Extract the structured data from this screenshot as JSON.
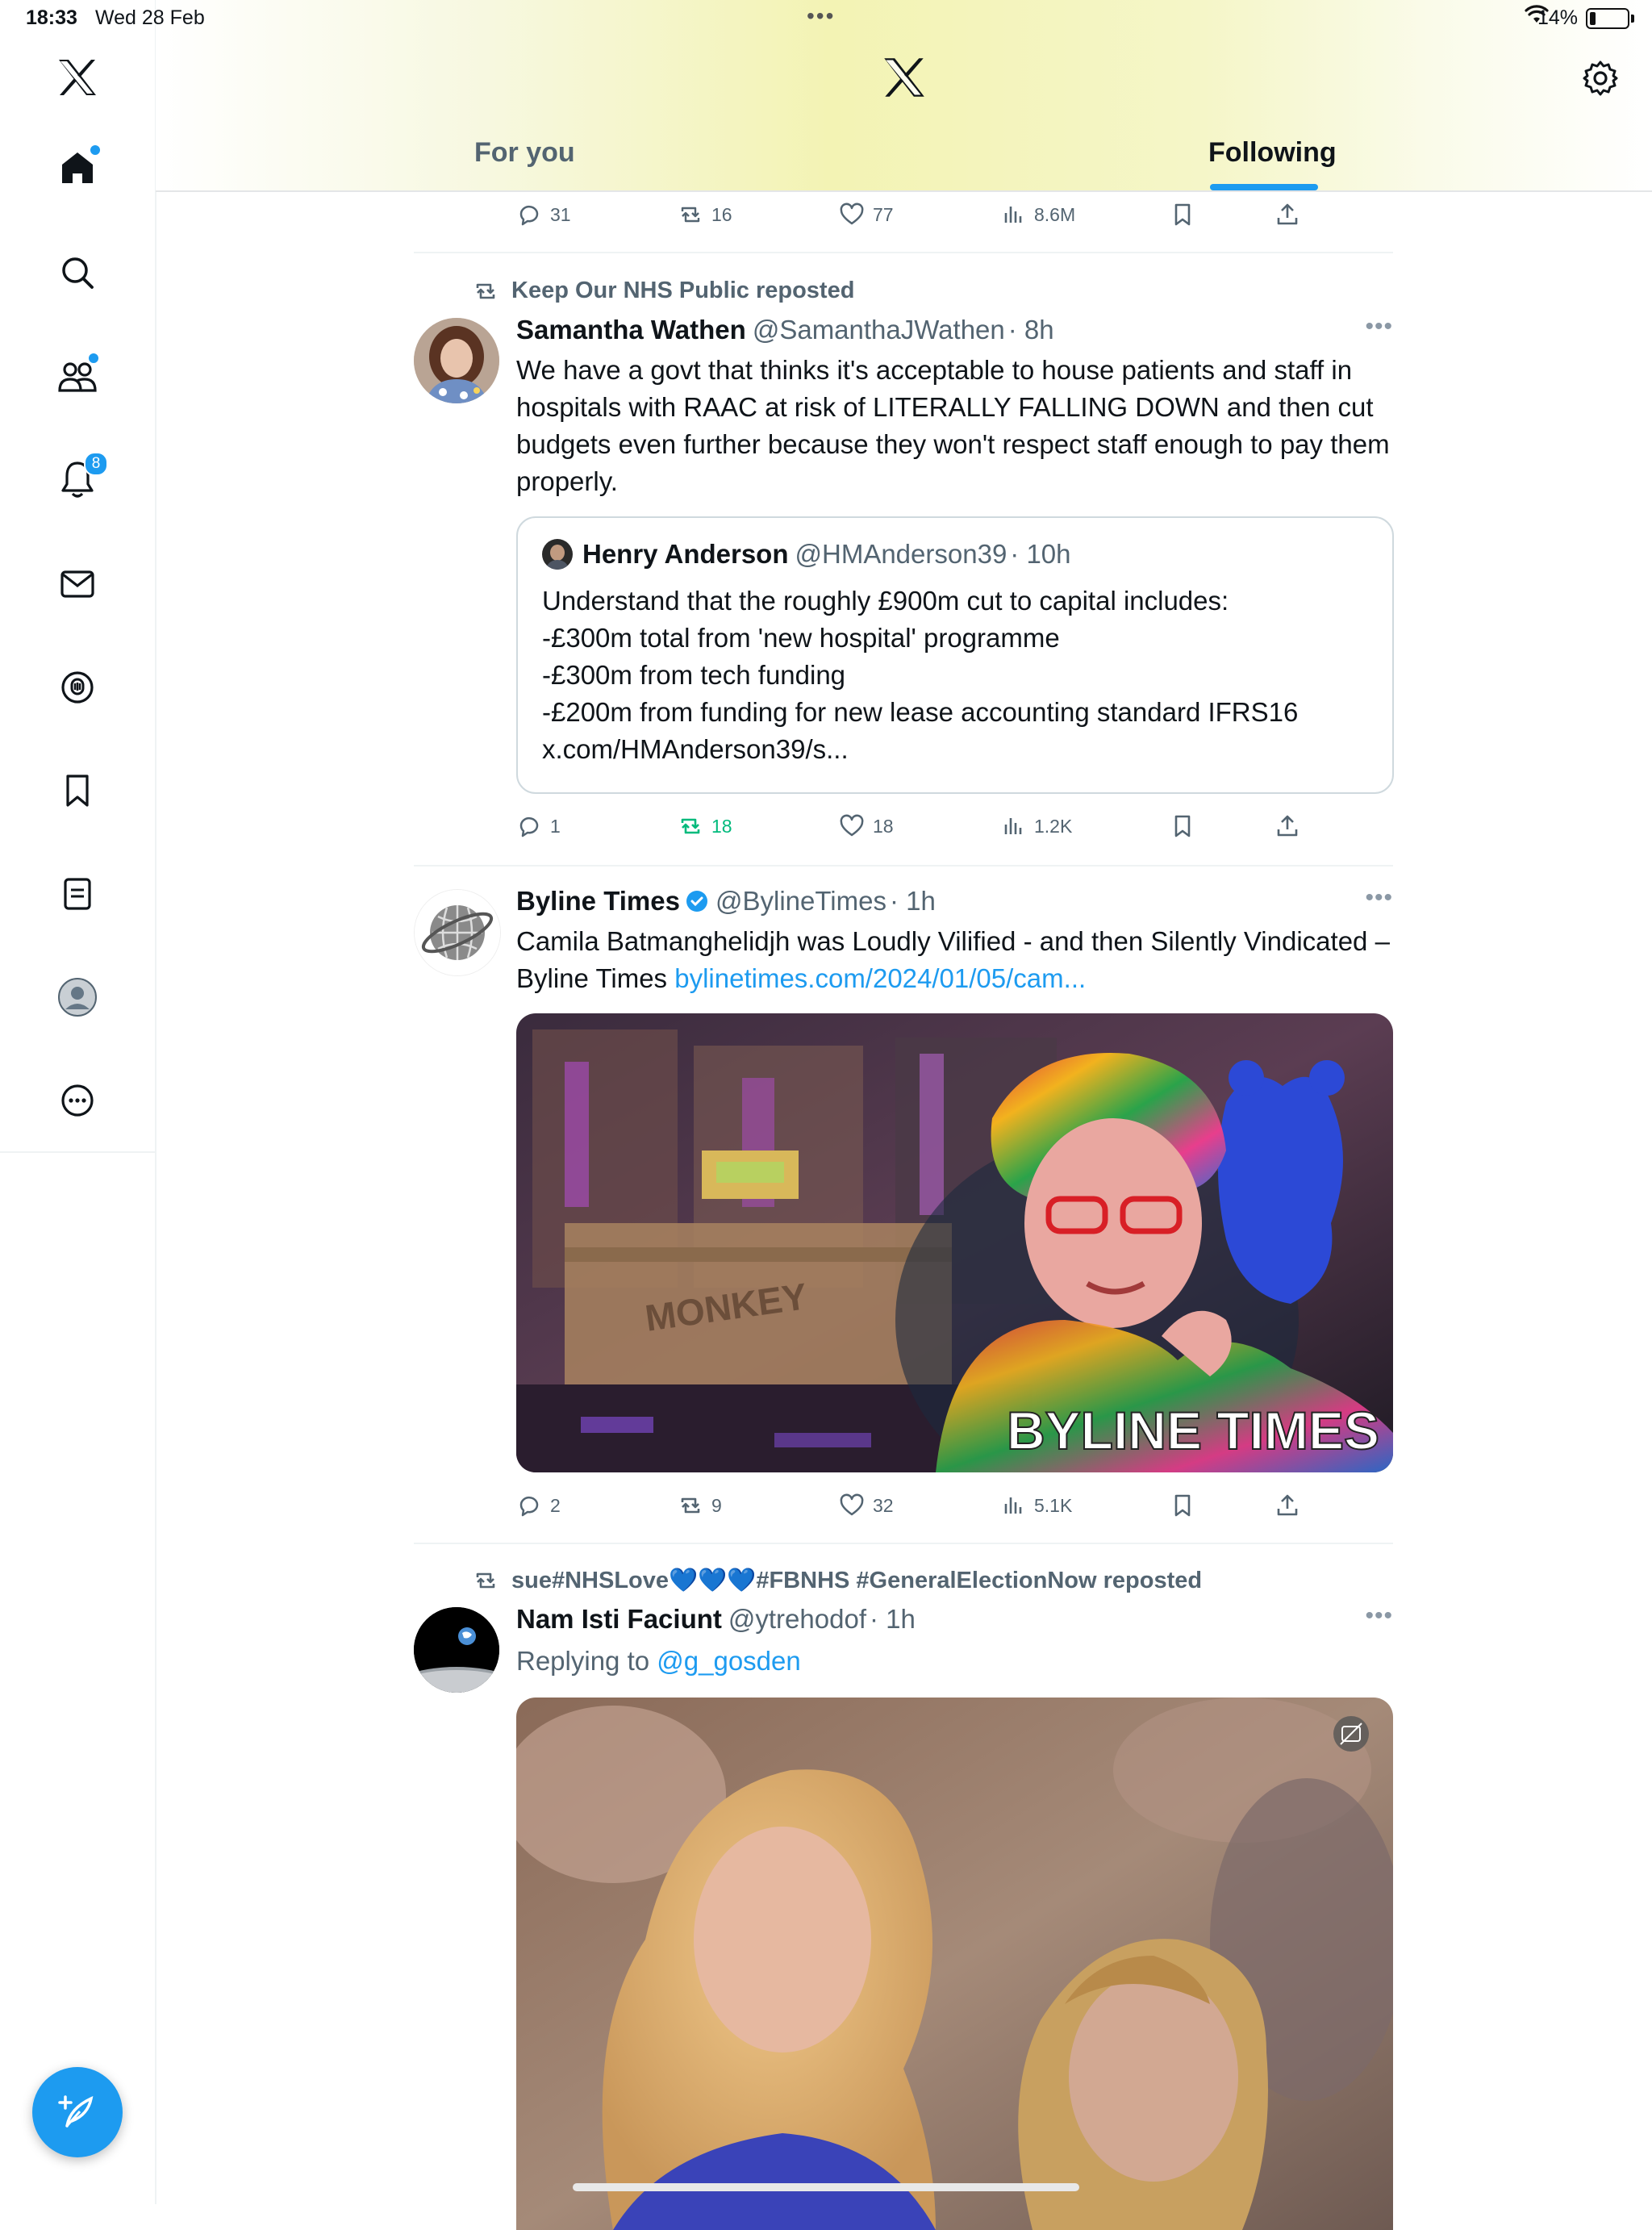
{
  "status_bar": {
    "time": "18:33",
    "date": "Wed 28 Feb",
    "battery": "14%"
  },
  "header": {
    "tabs": [
      "For you",
      "Following"
    ],
    "active_tab": "Following"
  },
  "sidebar": {
    "items": [
      "x-logo",
      "home",
      "search",
      "communities",
      "notifications",
      "messages",
      "spaces",
      "bookmarks",
      "lists",
      "profile",
      "more"
    ],
    "notification_count": "8"
  },
  "colors": {
    "accent": "#1d9bf0",
    "repost_active": "#00ba7c",
    "muted": "#536471"
  },
  "feed": {
    "top_actions": {
      "replies": "31",
      "reposts": "16",
      "likes": "77",
      "views": "8.6M"
    },
    "posts": [
      {
        "repost_label": "Keep Our NHS Public reposted",
        "name": "Samantha Wathen",
        "handle": "@SamanthaJWathen",
        "time": "· 8h",
        "text": "We have a govt that thinks it's acceptable to house patients and staff in hospitals with RAAC at risk of LITERALLY FALLING DOWN and then cut budgets even further because they won't respect staff enough to pay them properly.",
        "quote": {
          "name": "Henry Anderson",
          "handle": "@HMAnderson39",
          "time": "· 10h",
          "lines": [
            "Understand that the roughly £900m cut to capital includes:",
            "-£300m total from 'new hospital' programme",
            "-£300m from tech funding",
            "-£200m from funding for new lease accounting standard IFRS16",
            "x.com/HMAnderson39/s..."
          ]
        },
        "actions": {
          "replies": "1",
          "reposts": "18",
          "likes": "18",
          "views": "1.2K"
        }
      },
      {
        "name": "Byline Times",
        "handle": "@BylineTimes",
        "time": "· 1h",
        "text": "Camila Batmanghelidjh was Loudly Vilified - and then Silently Vindicated – Byline Times ",
        "link": "bylinetimes.com/2024/01/05/cam...",
        "image_watermark": "BYLINE TIMES",
        "image_text": "MONKEY",
        "actions": {
          "replies": "2",
          "reposts": "9",
          "likes": "32",
          "views": "5.1K"
        }
      },
      {
        "repost_label": "sue#NHSLove💙💙💙#FBNHS #GeneralElectionNow reposted",
        "name": "Nam Isti Faciunt",
        "handle": "@ytrehodof",
        "time": "· 1h",
        "replying_prefix": "Replying to ",
        "replying_to": "@g_gosden"
      }
    ]
  }
}
